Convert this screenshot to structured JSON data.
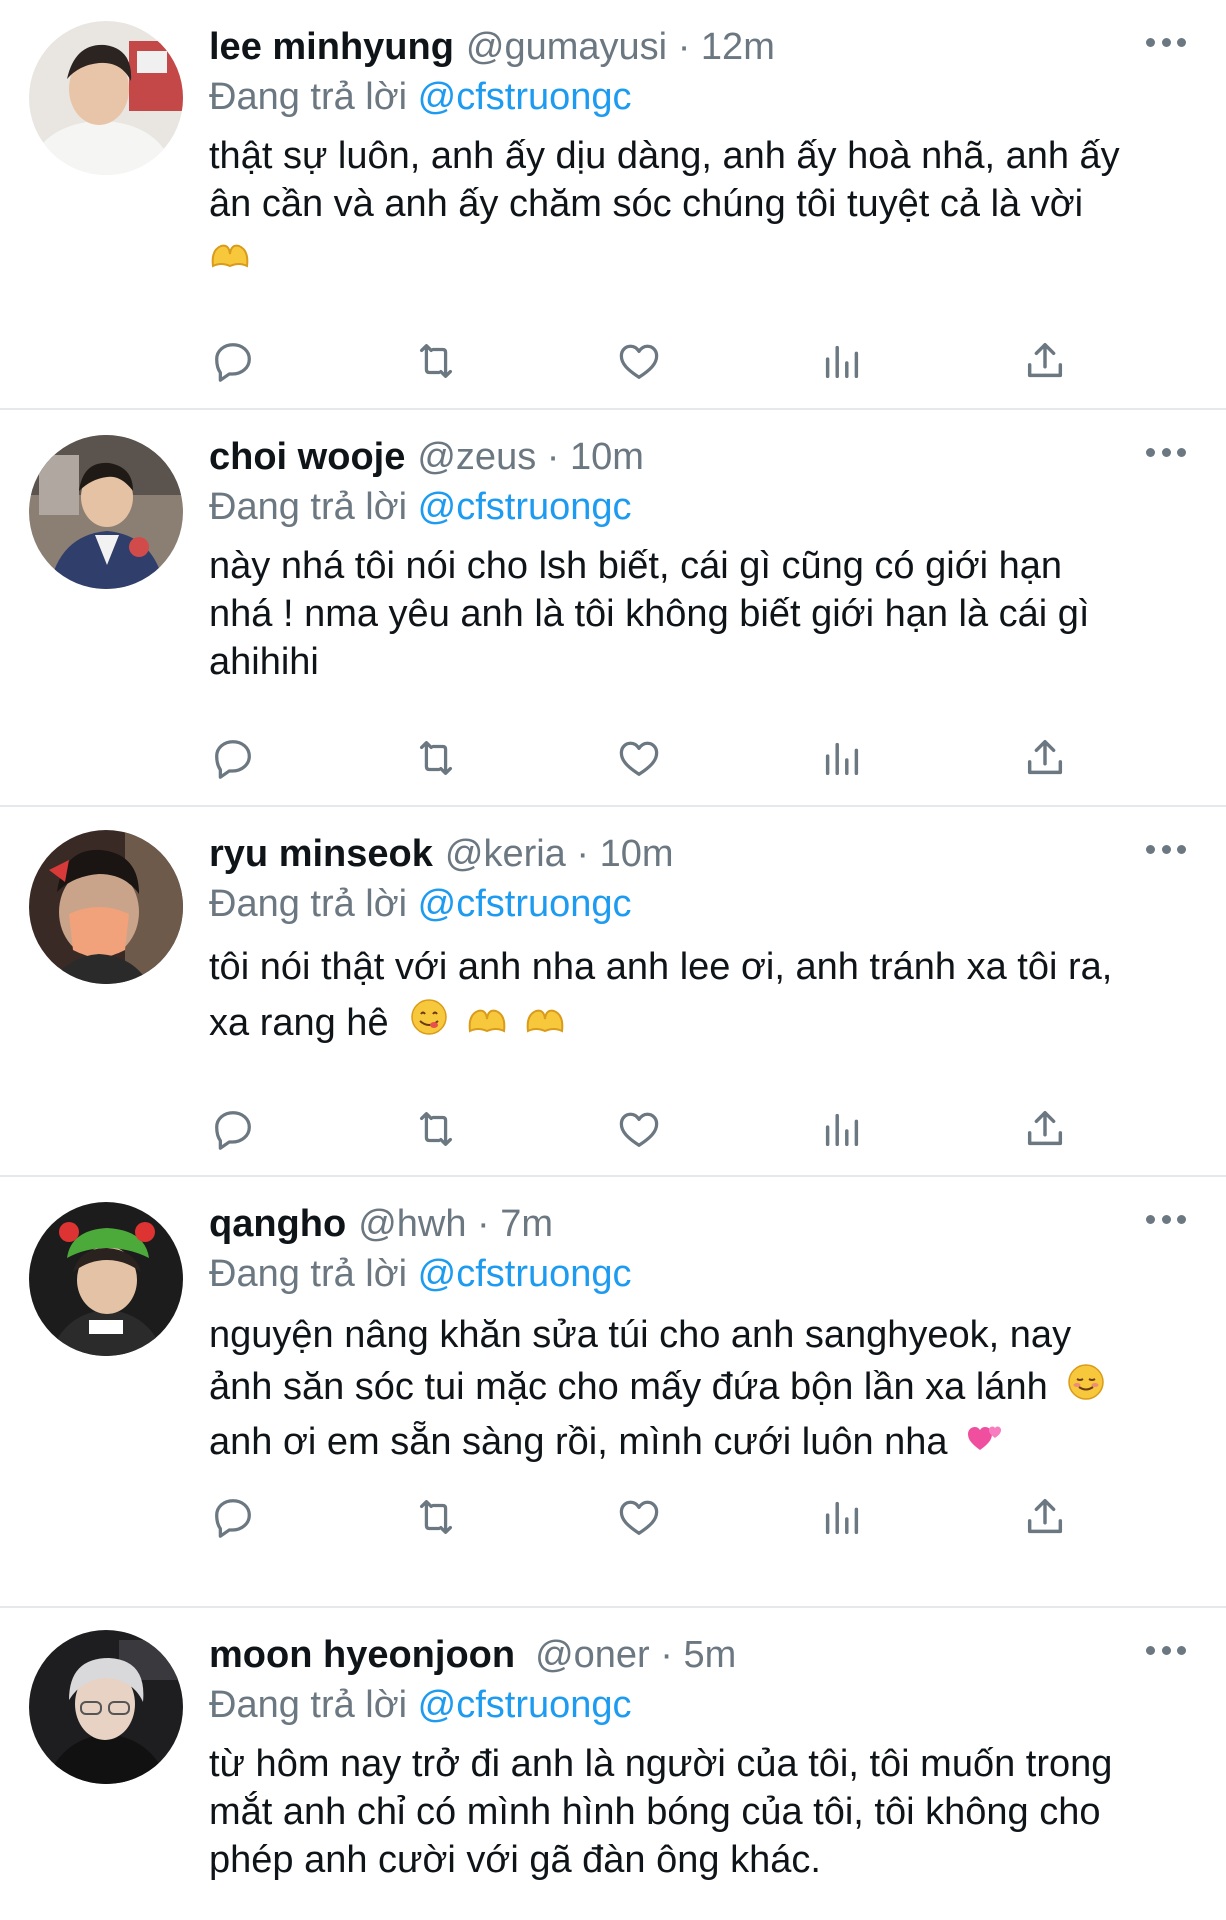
{
  "replying_prefix": "Đang trả lời",
  "colors": {
    "text": "#0f1419",
    "muted": "#6b7781",
    "link": "#1d9bf0",
    "divider": "#e6e9eb"
  },
  "icons": [
    "reply-icon",
    "retweet-icon",
    "like-icon",
    "views-icon",
    "share-icon",
    "more-icon"
  ],
  "tweets": [
    {
      "name": "lee minhyung",
      "handle": "@gumayusi",
      "time": "12m",
      "reply_to": "@cfstruongc",
      "lines": [
        "thật sự luôn, anh ấy dịu dàng, anh ấy hoà nhã, anh ấy",
        "ân cần và anh ấy chăm sóc chúng tôi tuyệt cả là vời"
      ],
      "emoji_line": "heart-hands"
    },
    {
      "name": "choi wooje",
      "handle": "@zeus",
      "time": "10m",
      "reply_to": "@cfstruongc",
      "lines": [
        "này nhá tôi nói cho lsh biết, cái gì cũng có giới hạn",
        "nhá ! nma yêu anh là tôi không biết giới hạn là cái gì",
        "ahihihi"
      ]
    },
    {
      "name": "ryu minseok",
      "handle": "@keria",
      "time": "10m",
      "reply_to": "@cfstruongc",
      "lines": [
        "tôi nói thật với anh nha anh lee ơi, anh tránh xa tôi ra,",
        "xa rang hê"
      ]
    },
    {
      "name": "qangho",
      "handle": "@hwh",
      "time": "7m",
      "reply_to": "@cfstruongc",
      "lines": [
        "nguyện nâng khăn sửa túi cho anh sanghyeok, nay",
        "ảnh săn sóc tui mặc cho mấy đứa bộn lần xa lánh",
        "anh ơi em sẵn sàng rồi, mình cưới luôn nha"
      ]
    },
    {
      "name": "moon hyeonjoon",
      "handle": "@oner",
      "time": "5m",
      "reply_to": "@cfstruongc",
      "lines": [
        "từ hôm nay trở đi anh là người của tôi, tôi muốn trong",
        "mắt anh chỉ có mình hình bóng của tôi, tôi không cho",
        "phép anh cười với gã đàn ông khác."
      ]
    }
  ]
}
